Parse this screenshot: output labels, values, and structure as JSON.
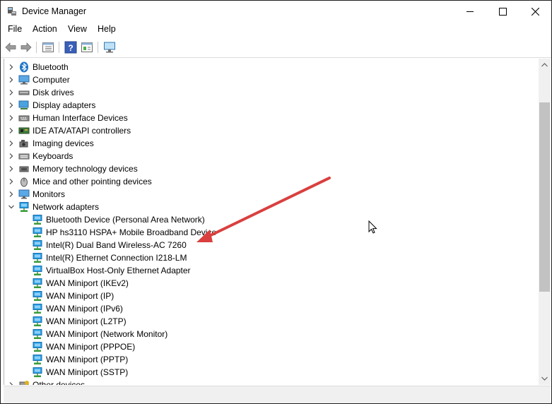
{
  "window": {
    "title": "Device Manager"
  },
  "menu": [
    "File",
    "Action",
    "View",
    "Help"
  ],
  "tree": {
    "categories": [
      {
        "label": "Bluetooth",
        "icon": "bluetooth-icon",
        "expanded": false
      },
      {
        "label": "Computer",
        "icon": "computer-icon",
        "expanded": false
      },
      {
        "label": "Disk drives",
        "icon": "disk-drive-icon",
        "expanded": false
      },
      {
        "label": "Display adapters",
        "icon": "display-adapter-icon",
        "expanded": false
      },
      {
        "label": "Human Interface Devices",
        "icon": "hid-icon",
        "expanded": false
      },
      {
        "label": "IDE ATA/ATAPI controllers",
        "icon": "ide-controller-icon",
        "expanded": false
      },
      {
        "label": "Imaging devices",
        "icon": "camera-icon",
        "expanded": false
      },
      {
        "label": "Keyboards",
        "icon": "keyboard-icon",
        "expanded": false
      },
      {
        "label": "Memory technology devices",
        "icon": "memory-icon",
        "expanded": false
      },
      {
        "label": "Mice and other pointing devices",
        "icon": "mouse-icon",
        "expanded": false
      },
      {
        "label": "Monitors",
        "icon": "monitor-icon",
        "expanded": false
      },
      {
        "label": "Network adapters",
        "icon": "network-adapter-icon",
        "expanded": true
      },
      {
        "label": "Other devices",
        "icon": "other-devices-icon",
        "expanded": false
      }
    ],
    "network_adapters": [
      "Bluetooth Device (Personal Area Network)",
      "HP hs3110 HSPA+ Mobile Broadband Device",
      "Intel(R) Dual Band Wireless-AC 7260",
      "Intel(R) Ethernet Connection I218-LM",
      "VirtualBox Host-Only Ethernet Adapter",
      "WAN Miniport (IKEv2)",
      "WAN Miniport (IP)",
      "WAN Miniport (IPv6)",
      "WAN Miniport (L2TP)",
      "WAN Miniport (Network Monitor)",
      "WAN Miniport (PPPOE)",
      "WAN Miniport (PPTP)",
      "WAN Miniport (SSTP)"
    ]
  },
  "colors": {
    "annotation_arrow": "#d9403f",
    "network_icon": "#1e8fd6"
  }
}
